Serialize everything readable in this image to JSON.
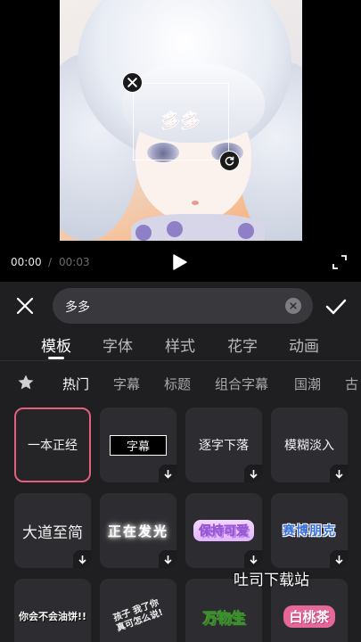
{
  "editor": {
    "overlay_text": "多多"
  },
  "player": {
    "current_time": "00:00",
    "separator": "/",
    "total_time": "00:03"
  },
  "search": {
    "value": "多多"
  },
  "tabs": [
    {
      "label": "模板",
      "active": true
    },
    {
      "label": "字体",
      "active": false
    },
    {
      "label": "样式",
      "active": false
    },
    {
      "label": "花字",
      "active": false
    },
    {
      "label": "动画",
      "active": false
    }
  ],
  "categories": [
    {
      "label": "热门",
      "active": true
    },
    {
      "label": "字幕",
      "active": false
    },
    {
      "label": "标题",
      "active": false
    },
    {
      "label": "组合字幕",
      "active": false
    },
    {
      "label": "国潮",
      "active": false
    },
    {
      "label": "古",
      "active": false
    }
  ],
  "templates": [
    {
      "label": "一本正经",
      "selected": true,
      "downloadable": false
    },
    {
      "label": "字幕",
      "selected": false,
      "downloadable": true
    },
    {
      "label": "逐字下落",
      "selected": false,
      "downloadable": true
    },
    {
      "label": "模糊淡入",
      "selected": false,
      "downloadable": true
    },
    {
      "label": "大道至简",
      "selected": false,
      "downloadable": true
    },
    {
      "label": "正在发光",
      "selected": false,
      "downloadable": true
    },
    {
      "label": "保持可爱",
      "selected": false,
      "downloadable": true
    },
    {
      "label": "赛博朋克",
      "selected": false,
      "downloadable": true
    },
    {
      "label": "你会不会油饼!!",
      "selected": false,
      "downloadable": false
    },
    {
      "label": "孩子 我了你 真可怎么说!",
      "selected": false,
      "downloadable": false
    },
    {
      "label": "万物生",
      "selected": false,
      "downloadable": false
    },
    {
      "label": "白桃茶",
      "selected": false,
      "downloadable": false
    }
  ],
  "watermark": "吐司下载站",
  "colors": {
    "panel_bg": "#1f1f21",
    "tile_bg": "#2d2d31",
    "selected_border": "#e0607e",
    "overlay_text": "#c4141b"
  }
}
